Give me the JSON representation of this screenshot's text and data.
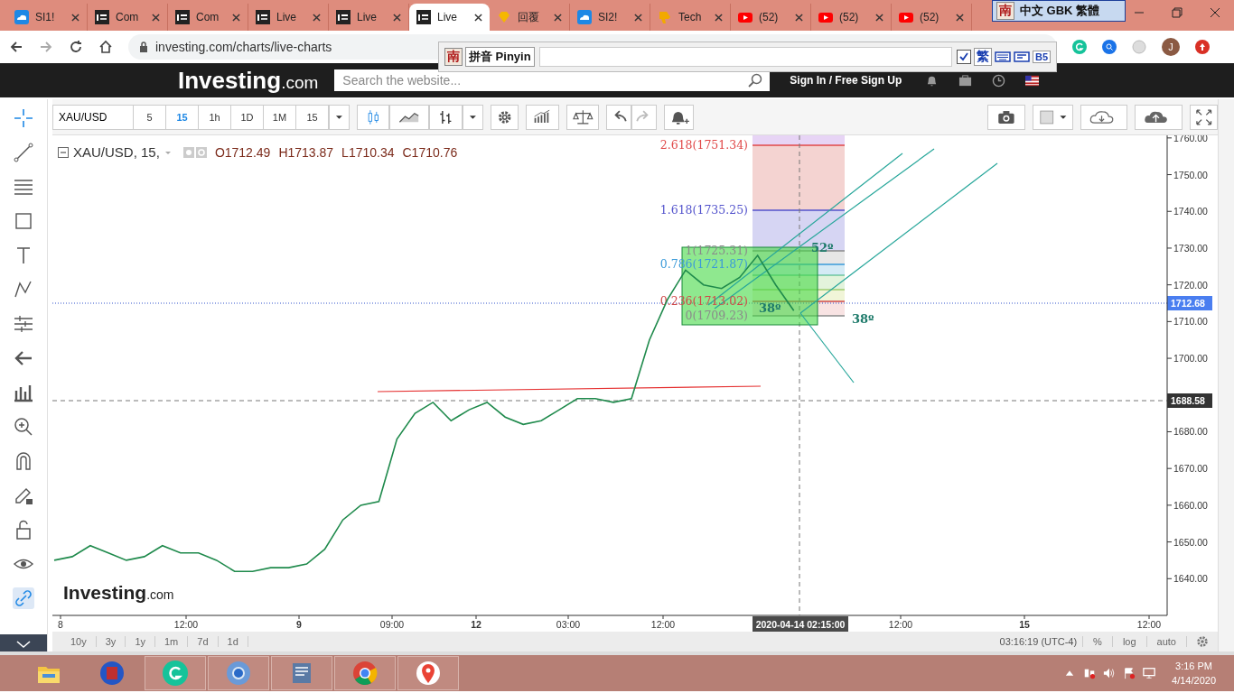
{
  "browser": {
    "tabs": [
      {
        "label": "SI1!",
        "kind": "cloud",
        "selected": false
      },
      {
        "label": "Com",
        "kind": "inv",
        "selected": false
      },
      {
        "label": "Com",
        "kind": "inv",
        "selected": false
      },
      {
        "label": "Live",
        "kind": "inv",
        "selected": false
      },
      {
        "label": "Live",
        "kind": "inv",
        "selected": false
      },
      {
        "label": "Live",
        "kind": "inv",
        "selected": true
      },
      {
        "label": "回覆",
        "kind": "gem",
        "selected": false
      },
      {
        "label": "SI2!",
        "kind": "cloud",
        "selected": false
      },
      {
        "label": "Tech",
        "kind": "thumb",
        "selected": false
      },
      {
        "label": "(52)",
        "kind": "youtube",
        "selected": false
      },
      {
        "label": "(52)",
        "kind": "youtube",
        "selected": false
      },
      {
        "label": "(52)",
        "kind": "youtube",
        "selected": false
      }
    ],
    "url": "investing.com/charts/live-charts",
    "avatar": "J"
  },
  "ime": {
    "badge": "南",
    "label": "中文 GBK 繁體"
  },
  "pinyin_bar": {
    "badge": "南",
    "label": "拼音 Pinyin",
    "checked": true,
    "traditional": "繁",
    "code": "B5"
  },
  "site_header": {
    "logo": "Investing",
    "logo_suffix": ".com",
    "search_placeholder": "Search the website...",
    "sign_in": "Sign In / Free Sign Up"
  },
  "toolbar": {
    "symbol": "XAU/USD",
    "intervals": [
      {
        "label": "5",
        "selected": false
      },
      {
        "label": "15",
        "selected": true
      },
      {
        "label": "1h",
        "selected": false
      },
      {
        "label": "1D",
        "selected": false
      },
      {
        "label": "1M",
        "selected": false
      }
    ],
    "interval_menu": "15"
  },
  "legend": {
    "symbol": "XAU/USD, 15,",
    "values": [
      "O1712.49",
      "H1713.87",
      "L1710.34",
      "C1710.76"
    ]
  },
  "chart": {
    "chart_data": {
      "type": "line",
      "categories": [
        null,
        null,
        null,
        null,
        null,
        null,
        null,
        null,
        null,
        null,
        null,
        null,
        null,
        null,
        null,
        null,
        null,
        null,
        null,
        null,
        null,
        null,
        null,
        null,
        null,
        null,
        null,
        null,
        null,
        null,
        null,
        null,
        null,
        null,
        null,
        null,
        null,
        null,
        null,
        null,
        null,
        null
      ],
      "series": [
        {
          "color": "#1f8a4c",
          "values": [
            1645,
            1646,
            1649,
            1647,
            1645,
            1646,
            1649,
            1647,
            1647,
            1645,
            1642,
            1642,
            1643,
            1643,
            1644,
            1648,
            1656,
            1660,
            1661,
            1678,
            1685,
            1688,
            1683,
            1686,
            1688,
            1684,
            1682,
            1683,
            1686,
            1689,
            1689,
            1688,
            1689,
            1705,
            1716,
            1724,
            1720,
            1719,
            1722,
            1728,
            1720,
            1713
          ]
        }
      ],
      "ylim": [
        1630,
        1760.7
      ],
      "yticks": [
        {
          "value": 1640,
          "label": "1640.00"
        },
        {
          "value": 1650,
          "label": "1650.00"
        },
        {
          "value": 1660,
          "label": "1660.00"
        },
        {
          "value": 1670,
          "label": "1670.00"
        },
        {
          "value": 1680,
          "label": "1680.00"
        },
        {
          "value": 1700,
          "label": "1700.00"
        },
        {
          "value": 1710,
          "label": "1710.00"
        },
        {
          "value": 1720,
          "label": "1720.00"
        },
        {
          "value": 1730,
          "label": "1730.00"
        },
        {
          "value": 1740,
          "label": "1740.00"
        },
        {
          "value": 1750,
          "label": "1750.00"
        },
        {
          "value": 1760,
          "label": "1760.00"
        }
      ]
    },
    "time_labels": [
      {
        "label": "8",
        "bold": false
      },
      {
        "label": "12:00",
        "bold": false
      },
      {
        "label": "9",
        "bold": true
      },
      {
        "label": "09:00",
        "bold": false
      },
      {
        "label": "12",
        "bold": true
      },
      {
        "label": "03:00",
        "bold": false
      },
      {
        "label": "12:00",
        "bold": false
      },
      {
        "label": "12:00",
        "bold": false
      },
      {
        "label": "15",
        "bold": true
      },
      {
        "label": "12:00",
        "bold": false
      }
    ],
    "watermark_logo": "Investing",
    "watermark_suffix": ".com",
    "price_labels": [
      {
        "label": "1712.68",
        "color": "#4a7ef0"
      },
      {
        "label": "1688.58",
        "color": "#333333"
      }
    ],
    "crosshair_time": "2020-04-14 02:15:00",
    "fib_levels": [
      {
        "label": "2.618(1751.34)",
        "color": "#e04848"
      },
      {
        "label": "1.618(1735.25)",
        "color": "#5252cc"
      },
      {
        "label": "1(1725.31)",
        "color": "#8a8a8a"
      },
      {
        "label": "0.786(1721.87)",
        "color": "#3a9ad9"
      },
      {
        "label": "0.236(1713.02)",
        "color": "#d04848"
      },
      {
        "label": "0(1709.23)",
        "color": "#8a8a8a"
      }
    ],
    "angles": [
      "52º",
      "38º",
      "38º"
    ]
  },
  "bottom_bar": {
    "ranges": [
      "10y",
      "3y",
      "1y",
      "1m",
      "7d",
      "1d"
    ],
    "clock": "03:16:19 (UTC-4)",
    "options": [
      "%",
      "log",
      "auto"
    ]
  },
  "taskbar": {
    "apps": [
      {
        "kind": "folder"
      },
      {
        "kind": "ime"
      },
      {
        "kind": "grammar"
      },
      {
        "kind": "browser"
      },
      {
        "kind": "window"
      },
      {
        "kind": "chrome"
      },
      {
        "kind": "maps"
      }
    ],
    "time": "3:16 PM",
    "date": "4/14/2020"
  }
}
